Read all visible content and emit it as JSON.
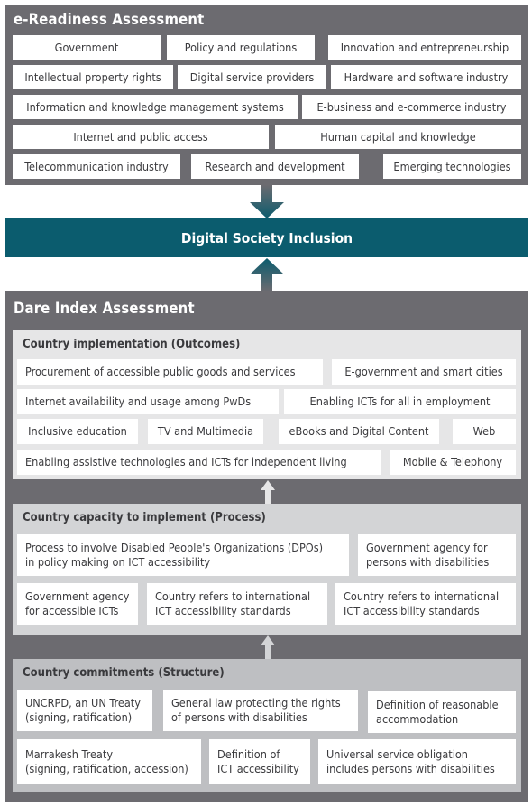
{
  "ereadiness": {
    "title": "e-Readiness Assessment",
    "rows": [
      [
        "Government",
        "Policy and regulations",
        "Innovation and entrepreneurship"
      ],
      [
        "Intellectual property rights",
        "Digital service providers",
        "Hardware and software industry"
      ],
      [
        "Information and knowledge management systems",
        "E-business and e-commerce industry"
      ],
      [
        "Internet and public access",
        "Human capital and knowledge"
      ],
      [
        "Telecommunication industry",
        "Research and development",
        "Emerging technologies"
      ]
    ]
  },
  "center": {
    "label": "Digital Society Inclusion"
  },
  "dare": {
    "title": "Dare Index Assessment",
    "outcomes": {
      "title": "Country implementation (Outcomes)",
      "rows": [
        [
          "Procurement of accessible public goods and services",
          "E-government and smart cities"
        ],
        [
          "Internet availability and usage among PwDs",
          "Enabling ICTs for all in employment"
        ],
        [
          "Inclusive education",
          "TV and Multimedia",
          "eBooks and Digital Content",
          "Web"
        ],
        [
          "Enabling assistive technologies and ICTs for independent living",
          "Mobile & Telephony"
        ]
      ]
    },
    "process": {
      "title": "Country capacity to implement (Process)",
      "rows": [
        [
          [
            "Process to involve Disabled People's Organizations (DPOs)",
            "in policy making on ICT accessibility"
          ],
          [
            "Government agency for",
            "persons with disabilities"
          ]
        ],
        [
          [
            "Government agency",
            "for accessible ICTs"
          ],
          [
            "Country refers to international",
            "ICT accessibility standards"
          ],
          [
            "Country refers to international",
            "ICT accessibility standards"
          ]
        ]
      ]
    },
    "structure": {
      "title": "Country commitments (Structure)",
      "rows": [
        [
          [
            "UNCRPD, an UN Treaty",
            "(signing, ratification)"
          ],
          [
            "General law protecting the rights",
            "of  persons with disabilities"
          ],
          [
            "Definition of reasonable",
            "accommodation"
          ]
        ],
        [
          [
            "Marrakesh Treaty",
            "(signing, ratification, accession)"
          ],
          [
            "Definition of",
            "ICT accessibility"
          ],
          [
            "Universal service obligation",
            "includes persons with disabilities"
          ]
        ]
      ]
    }
  },
  "colors": {
    "panel_gray": "#6c6b70",
    "teal": "#0b5c6e",
    "outcomes_bg": "#e6e6e7",
    "process_bg": "#d3d4d6",
    "structure_bg": "#bebfc2"
  }
}
